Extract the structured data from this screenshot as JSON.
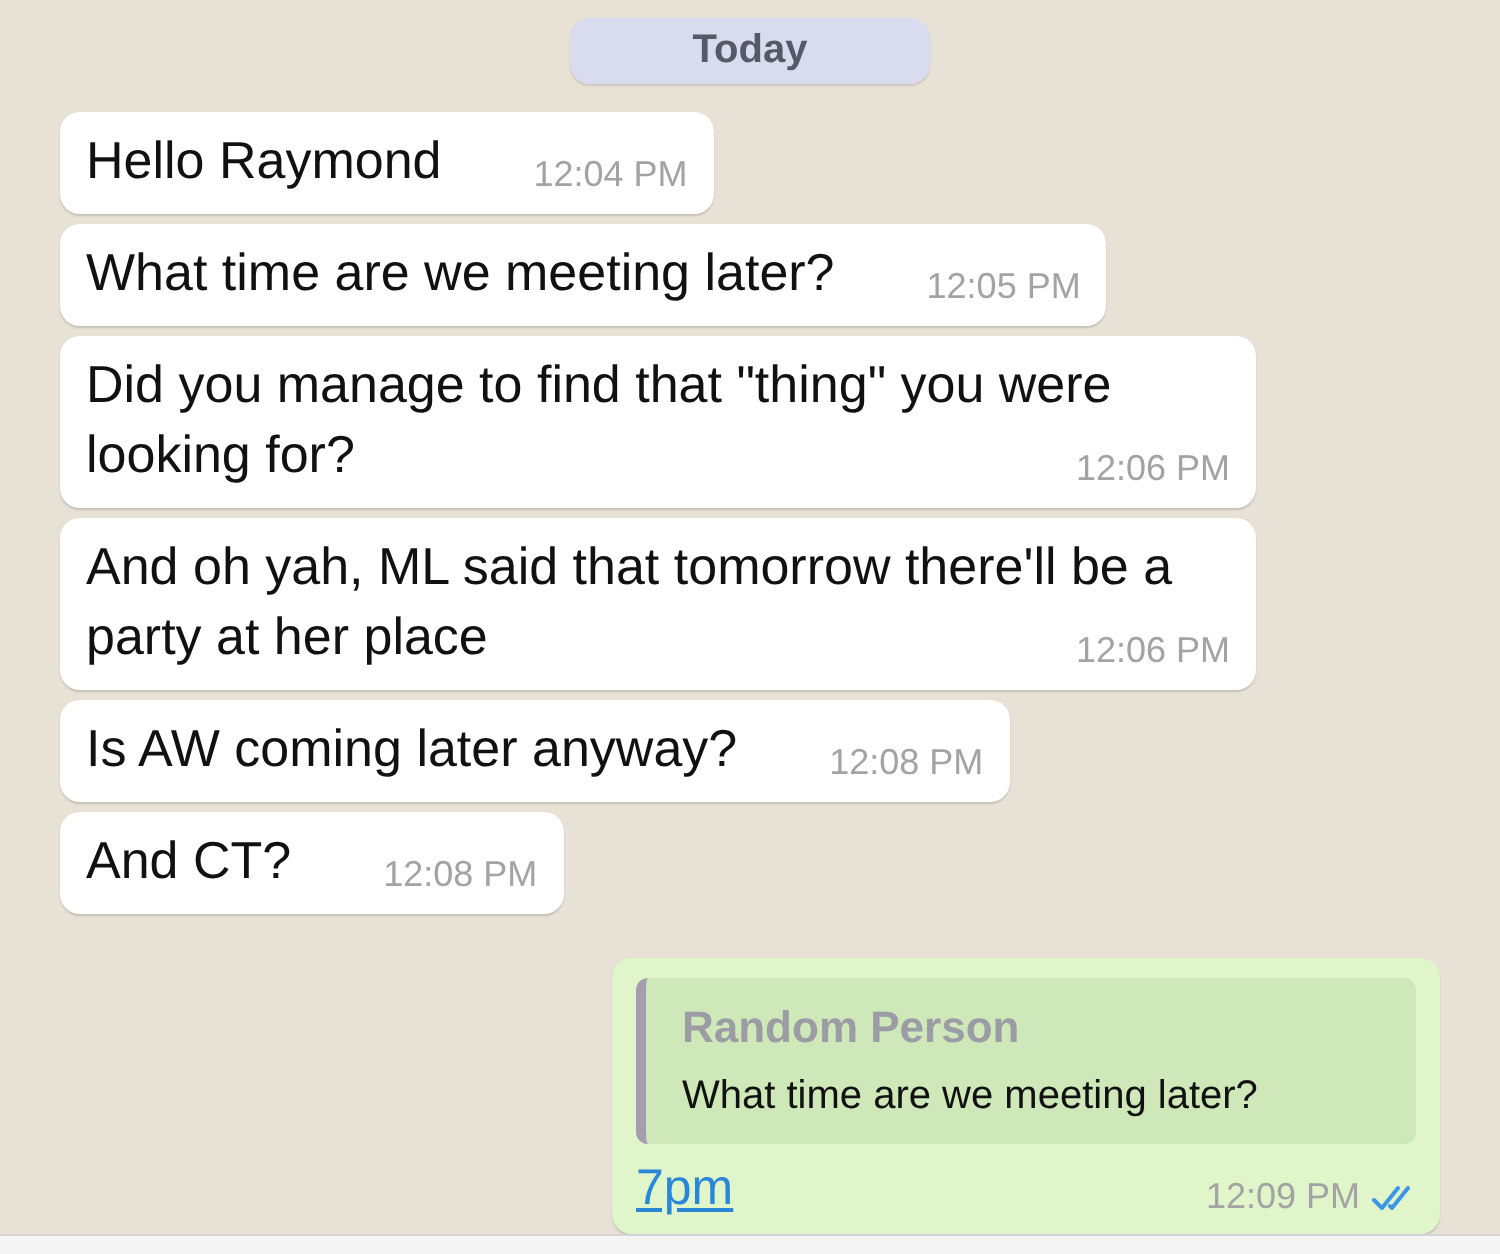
{
  "date_chip": "Today",
  "messages": [
    {
      "text": "Hello Raymond",
      "time": "12:04 PM"
    },
    {
      "text": "What time are we meeting later?",
      "time": "12:05 PM"
    },
    {
      "text": "Did you manage to find that \"thing\" you were looking for?",
      "time": "12:06 PM"
    },
    {
      "text": "And oh yah, ML said that tomorrow there'll be a party at her place",
      "time": "12:06 PM"
    },
    {
      "text": "Is AW coming later anyway?",
      "time": "12:08 PM"
    },
    {
      "text": "And CT?",
      "time": "12:08 PM"
    }
  ],
  "reply": {
    "quote": {
      "sender": "Random Person",
      "text": "What time are we meeting later?"
    },
    "link": "7pm",
    "time": "12:09 PM",
    "read": true
  }
}
